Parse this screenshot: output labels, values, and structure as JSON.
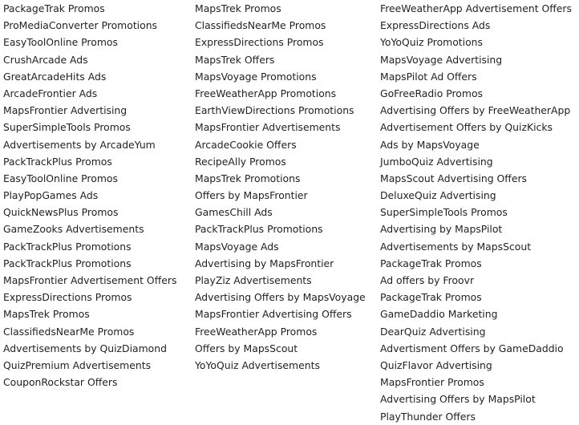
{
  "columns": [
    [
      "PackageTrak Promos",
      "ProMediaConverter Promotions",
      "EasyToolOnline Promos",
      "CrushArcade Ads",
      "GreatArcadeHits Ads",
      "ArcadeFrontier Ads",
      "MapsFrontier Advertising",
      "SuperSimpleTools Promos",
      "Advertisements by ArcadeYum",
      "PackTrackPlus Promos",
      "EasyToolOnline Promos",
      "PlayPopGames Ads",
      "QuickNewsPlus Promos",
      "GameZooks Advertisements",
      "PackTrackPlus Promotions",
      "PackTrackPlus Promotions",
      "MapsFrontier Advertisement Offers",
      "ExpressDirections Promos",
      "MapsTrek Promos",
      "ClassifiedsNearMe Promos",
      "Advertisements by QuizDiamond",
      "QuizPremium Advertisements",
      "CouponRockstar Offers"
    ],
    [
      "MapsTrek Promos",
      "ClassifiedsNearMe Promos",
      "ExpressDirections Promos",
      "MapsTrek Offers",
      "MapsVoyage Promotions",
      "FreeWeatherApp Promotions",
      "EarthViewDirections Promotions",
      "MapsFrontier Advertisements",
      "ArcadeCookie Offers",
      "RecipeAlly Promos",
      "MapsTrek Promotions",
      "Offers by MapsFrontier",
      "GamesChill Ads",
      "PackTrackPlus Promotions",
      "MapsVoyage Ads",
      "Advertising by MapsFrontier",
      "PlayZiz Advertisements",
      "Advertising Offers by MapsVoyage",
      "MapsFrontier Advertising Offers",
      "FreeWeatherApp Promos",
      "Offers by MapsScout",
      "YoYoQuiz Advertisements"
    ],
    [
      "FreeWeatherApp Advertisement Offers",
      "ExpressDirections Ads",
      "YoYoQuiz Promotions",
      "MapsVoyage Advertising",
      "MapsPilot Ad Offers",
      "GoFreeRadio Promos",
      "Advertising Offers by FreeWeatherApp",
      "Advertisement Offers by QuizKicks",
      "Ads by MapsVoyage",
      "JumboQuiz Advertising",
      "MapsScout Advertising Offers",
      "DeluxeQuiz Advertising",
      "SuperSimpleTools Promos",
      "Advertising by MapsPilot",
      "Advertisements by MapsScout",
      "PackageTrak Promos",
      "Ad offers by Froovr",
      "PackageTrak Promos",
      "GameDaddio Marketing",
      "DearQuiz Advertising",
      "Advertisment Offers by GameDaddio",
      "QuizFlavor Advertising",
      "MapsFrontier Promos",
      "Advertising Offers by MapsPilot",
      "PlayThunder Offers"
    ]
  ]
}
